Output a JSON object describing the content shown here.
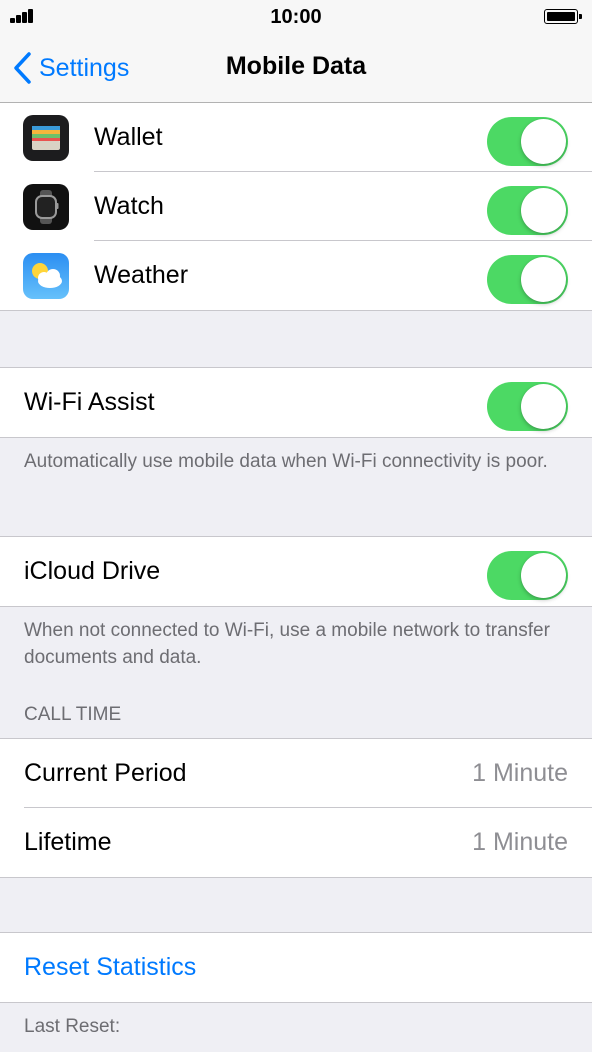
{
  "status_bar": {
    "time": "10:00"
  },
  "nav": {
    "back_label": "Settings",
    "title": "Mobile Data"
  },
  "apps": [
    {
      "name": "Wallet",
      "icon": "wallet-icon",
      "enabled": true
    },
    {
      "name": "Watch",
      "icon": "watch-icon",
      "enabled": true
    },
    {
      "name": "Weather",
      "icon": "weather-icon",
      "enabled": true
    }
  ],
  "wifi_assist": {
    "label": "Wi-Fi Assist",
    "enabled": true,
    "footnote": "Automatically use mobile data when Wi-Fi connectivity is poor."
  },
  "icloud_drive": {
    "label": "iCloud Drive",
    "enabled": true,
    "footnote": "When not connected to Wi-Fi, use a mobile network to transfer documents and data."
  },
  "call_time": {
    "header": "CALL TIME",
    "rows": [
      {
        "label": "Current Period",
        "value": "1 Minute"
      },
      {
        "label": "Lifetime",
        "value": "1 Minute"
      }
    ]
  },
  "reset": {
    "label": "Reset Statistics",
    "last_reset": "Last Reset:"
  },
  "colors": {
    "accent": "#007aff",
    "toggle_on": "#4cd964",
    "background": "#efeff4"
  }
}
